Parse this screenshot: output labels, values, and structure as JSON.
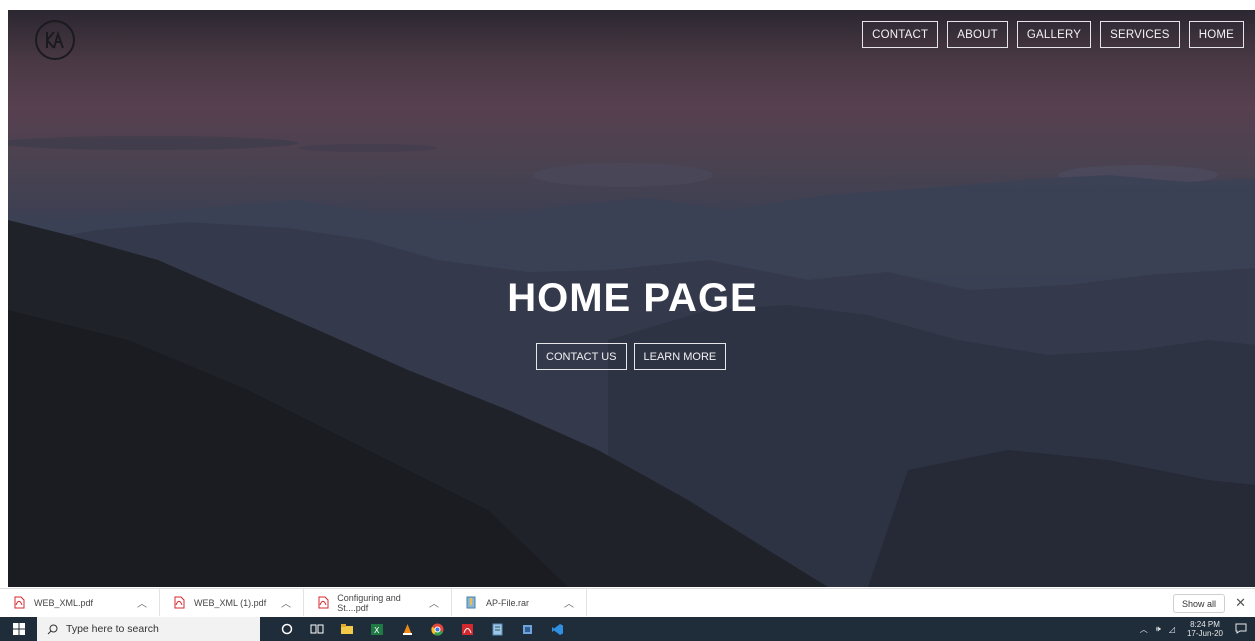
{
  "nav": {
    "items": [
      "CONTACT",
      "ABOUT",
      "GALLERY",
      "SERVICES",
      "HOME"
    ]
  },
  "hero": {
    "title": "HOME PAGE",
    "contact_us_label": "CONTACT US",
    "learn_more_label": "LEARN MORE"
  },
  "downloads": {
    "items": [
      {
        "name": "WEB_XML.pdf",
        "icon": "pdf-icon"
      },
      {
        "name": "WEB_XML (1).pdf",
        "icon": "pdf-icon"
      },
      {
        "name": "Configuring and St....pdf",
        "icon": "pdf-icon"
      },
      {
        "name": "AP-File.rar",
        "icon": "archive-icon"
      }
    ],
    "show_all_label": "Show all",
    "close_label": "✕"
  },
  "taskbar": {
    "search_placeholder": "Type here to search",
    "time": "8:24 PM",
    "date": "17-Jun-20"
  },
  "colors": {
    "accent_pdf": "#d4282f",
    "taskbar_bg": "#1f2c3a",
    "nav_border": "#e6e6ea"
  }
}
